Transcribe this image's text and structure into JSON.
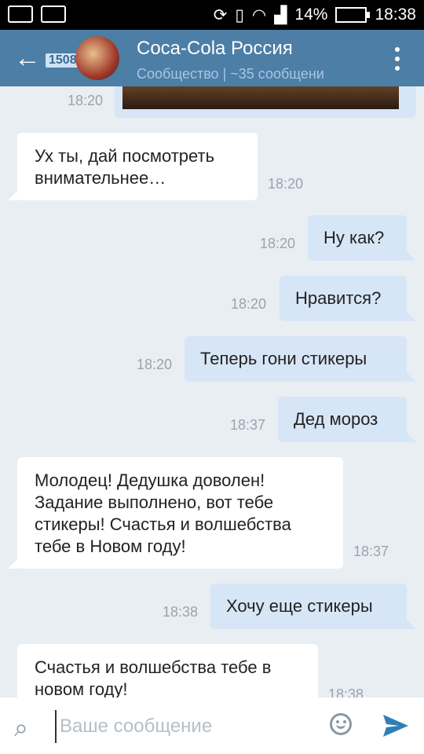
{
  "status_bar": {
    "battery": "14%",
    "time": "18:38"
  },
  "header": {
    "badge": "1508",
    "title": "Coca-Cola Россия",
    "subtitle": "Сообщество | ~35 сообщени"
  },
  "messages": [
    {
      "dir": "out",
      "text": "",
      "time": "18:20",
      "kind": "photo"
    },
    {
      "dir": "in",
      "text": "Ух ты, дай посмотреть внимательнее…",
      "time": "18:20"
    },
    {
      "dir": "out",
      "text": "Ну как?",
      "time": "18:20"
    },
    {
      "dir": "out",
      "text": "Нравится?",
      "time": "18:20"
    },
    {
      "dir": "out",
      "text": "Теперь гони стикеры",
      "time": "18:20"
    },
    {
      "dir": "out",
      "text": "Дед мороз",
      "time": "18:37"
    },
    {
      "dir": "in",
      "text": "Молодец! Дедушка доволен! Задание выполнено, вот тебе стикеры! Счастья и волшебства тебе в Новом году!",
      "time": "18:37"
    },
    {
      "dir": "out",
      "text": "Хочу еще стикеры",
      "time": "18:38"
    },
    {
      "dir": "in",
      "text": "Счастья и волшебства тебе в новом году!",
      "time": "18:38"
    }
  ],
  "composer": {
    "placeholder": "Ваше сообщение"
  },
  "colors": {
    "header": "#4c7ea6",
    "bubble_out": "#d7e6f6",
    "bubble_in": "#ffffff",
    "chat_bg": "#e9eef3",
    "send": "#2f7fb6"
  },
  "icons": [
    "back-arrow-icon",
    "more-vertical-icon",
    "paperclip-icon",
    "smile-icon",
    "send-icon",
    "wifi-icon",
    "signal-icon",
    "battery-icon",
    "sync-icon",
    "vibrate-icon"
  ]
}
